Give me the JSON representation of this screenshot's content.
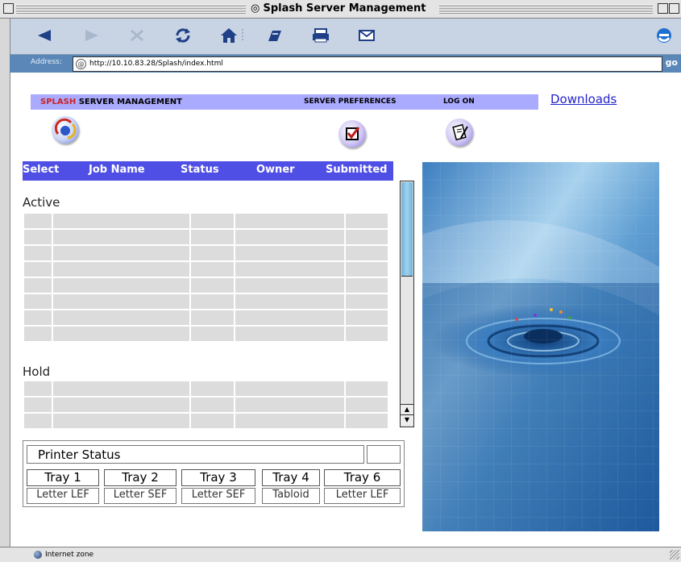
{
  "window": {
    "title": "Splash Server Management"
  },
  "address_bar": {
    "label": "Address:",
    "url": "http://10.10.83.28/Splash/index.html",
    "go_label": "go"
  },
  "toolbar": {
    "buttons": [
      "back-icon",
      "forward-icon",
      "stop-icon",
      "refresh-icon",
      "home-icon",
      "autofill-icon",
      "print-icon",
      "mail-icon"
    ]
  },
  "nav": {
    "brand_red": "SPLASH",
    "brand_rest": " SERVER MANAGEMENT",
    "server_prefs": "SERVER PREFERENCES",
    "log_on": "LOG ON",
    "downloads": "Downloads"
  },
  "jobs": {
    "headers": [
      "Select",
      "Job Name",
      "Status",
      "Owner",
      "Submitted"
    ],
    "active_label": "Active",
    "hold_label": "Hold",
    "active_rows": 8,
    "hold_rows": 3
  },
  "printer": {
    "label": "Printer Status",
    "status_value": "",
    "trays": [
      "Tray 1",
      "Tray 2",
      "Tray 3",
      "Tray 4",
      "Tray 6"
    ],
    "papers": [
      "Letter LEF",
      "Letter SEF",
      "Letter SEF",
      "Tabloid",
      "Letter LEF"
    ]
  },
  "statusbar": {
    "zone": "Internet zone"
  },
  "colors": {
    "nav_bar": "#aaaaff",
    "brand_red": "#cc2222",
    "job_header": "#4f4fe6",
    "grid_cell": "#dcdcdc",
    "link": "#2222cc"
  }
}
